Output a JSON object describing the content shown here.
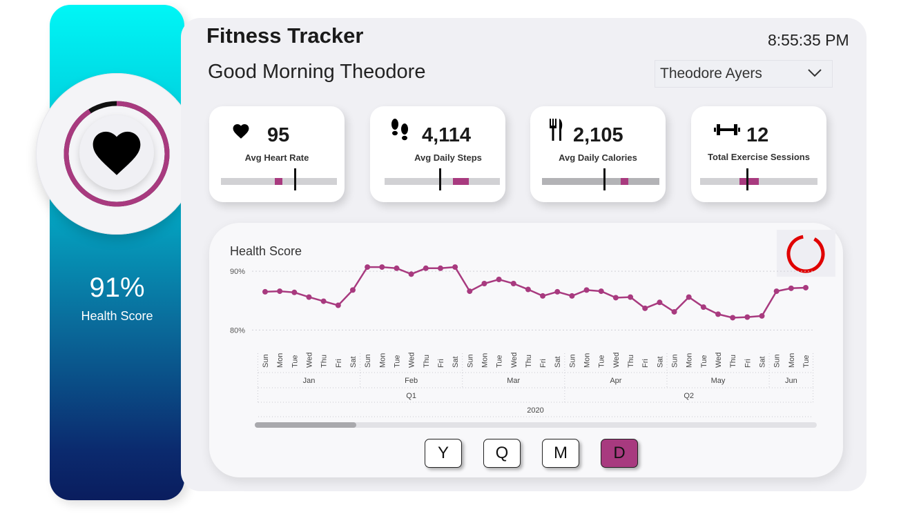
{
  "header": {
    "app_title": "Fitness Tracker",
    "clock": "8:55:35 PM",
    "greeting": "Good Morning Theodore",
    "user_select": {
      "selected": "Theodore Ayers"
    }
  },
  "left_panel": {
    "score_percent": "91%",
    "score_label": "Health Score",
    "ring_fraction": 0.91,
    "icon": "heart-icon"
  },
  "kpis": [
    {
      "icon": "heart-icon",
      "value": "95",
      "label": "Avg Heart Rate"
    },
    {
      "icon": "footsteps-icon",
      "value": "4,114",
      "label": "Avg Daily Steps"
    },
    {
      "icon": "fork-knife-icon",
      "value": "2,105",
      "label": "Avg Daily Calories"
    },
    {
      "icon": "dumbbell-icon",
      "value": "12",
      "label": "Total Exercise Sessions"
    }
  ],
  "chart": {
    "title": "Health Score",
    "scroll_thumb": "scroll position",
    "granularity_buttons": [
      {
        "label": "Y",
        "active": false
      },
      {
        "label": "Q",
        "active": false
      },
      {
        "label": "M",
        "active": false
      },
      {
        "label": "D",
        "active": true
      }
    ]
  },
  "chart_data": {
    "type": "line",
    "title": "Health Score",
    "y_ticks": [
      "90%",
      "80%"
    ],
    "ylim": [
      77,
      92
    ],
    "grid": true,
    "x": [
      "Sun",
      "Mon",
      "Tue",
      "Wed",
      "Thu",
      "Fri",
      "Sat",
      "Sun",
      "Mon",
      "Tue",
      "Wed",
      "Thu",
      "Fri",
      "Sat",
      "Sun",
      "Mon",
      "Tue",
      "Wed",
      "Thu",
      "Fri",
      "Sat",
      "Sun",
      "Mon",
      "Tue",
      "Wed",
      "Thu",
      "Fri",
      "Sat",
      "Sun",
      "Mon",
      "Tue",
      "Wed",
      "Thu",
      "Fri",
      "Sat",
      "Sun",
      "Mon",
      "Tue"
    ],
    "months": [
      {
        "label": "Jan",
        "start": 0,
        "end": 6
      },
      {
        "label": "Feb",
        "start": 7,
        "end": 13
      },
      {
        "label": "Mar",
        "start": 14,
        "end": 20
      },
      {
        "label": "Apr",
        "start": 21,
        "end": 27
      },
      {
        "label": "May",
        "start": 28,
        "end": 34
      },
      {
        "label": "Jun",
        "start": 35,
        "end": 37
      }
    ],
    "quarters": [
      {
        "label": "Q1",
        "start": 0,
        "end": 20
      },
      {
        "label": "Q2",
        "start": 21,
        "end": 37
      }
    ],
    "year": "2020",
    "series": [
      {
        "color": "#a83a7f",
        "values": [
          86.5,
          86.6,
          86.4,
          85.6,
          84.9,
          84.2,
          86.8,
          90.7,
          90.7,
          90.5,
          89.5,
          90.5,
          90.5,
          90.7,
          86.6,
          87.9,
          88.6,
          87.9,
          86.9,
          85.8,
          86.5,
          85.8,
          86.8,
          86.6,
          85.5,
          85.6,
          83.7,
          84.7,
          83.1,
          85.6,
          83.9,
          82.7,
          82.1,
          82.2,
          82.4,
          86.6,
          87.1,
          87.2
        ]
      }
    ]
  },
  "colors": {
    "accent": "#a83a7f",
    "spinner": "#e00000",
    "panel_bg": "#f0f0f4"
  }
}
